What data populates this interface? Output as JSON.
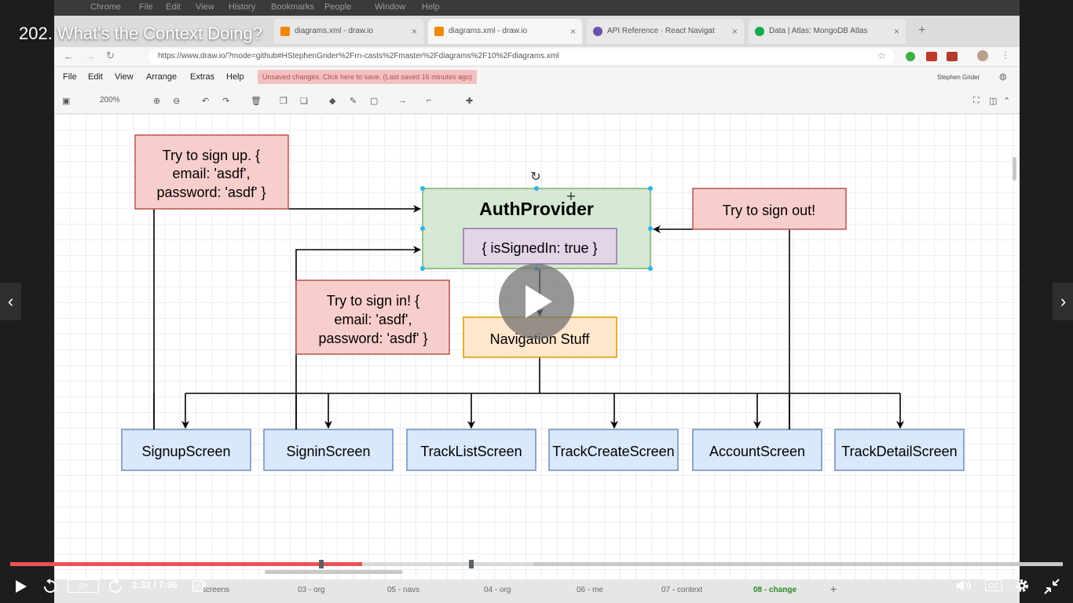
{
  "video_title": "202. What's the Context Doing?",
  "browser": {
    "mac_menu": [
      "Chrome",
      "File",
      "Edit",
      "View",
      "History",
      "Bookmarks",
      "People",
      "Window",
      "Help"
    ],
    "tabs": [
      {
        "label": "diagrams.xml - draw.io",
        "fav_color": "#f08705"
      },
      {
        "label": "diagrams.xml - draw.io",
        "fav_color": "#f08705"
      },
      {
        "label": "API Reference · React Navigat",
        "fav_color": "#6b52ae"
      },
      {
        "label": "Data | Atlas: MongoDB Atlas",
        "fav_color": "#13aa52"
      }
    ],
    "url": "https://www.draw.io/?mode=github#HStephenGrider%2Frn-casts%2Fmaster%2Fdiagrams%2F10%2Fdiagrams.xml"
  },
  "drawio": {
    "menu": [
      "File",
      "Edit",
      "View",
      "Arrange",
      "Extras",
      "Help"
    ],
    "unsaved": "Unsaved changes. Click here to save. (Last saved 16 minutes ago)",
    "user": "Stephen Grider",
    "zoom": "200%",
    "bottom_tabs": [
      "screens",
      "03 - org",
      "05 - navs",
      "04 - org",
      "06 - me",
      "07 - context",
      "08 - change"
    ]
  },
  "diagram": {
    "signup_note": [
      "Try to sign up.  {",
      "email: 'asdf',",
      "password: 'asdf' }"
    ],
    "auth_title": "AuthProvider",
    "auth_state": "{ isSignedIn: true }",
    "signout_note": "Try to sign out!",
    "signin_note": [
      "Try to sign in! {",
      "email: 'asdf',",
      "password: 'asdf' }"
    ],
    "navigation": "Navigation Stuff",
    "screens": [
      "SignupScreen",
      "SigninScreen",
      "TrackListScreen",
      "TrackCreateScreen",
      "AccountScreen",
      "TrackDetailScreen"
    ],
    "colors": {
      "note_fill": "#f8cecc",
      "note_stroke": "#b85450",
      "auth_fill": "#d5e8d4",
      "auth_stroke": "#82b366",
      "state_fill": "#e1d5e7",
      "state_stroke": "#9673a6",
      "nav_fill": "#ffe6cc",
      "nav_stroke": "#d79b00",
      "screen_fill": "#dae8fc",
      "screen_stroke": "#6c8ebf"
    }
  },
  "player": {
    "speed": "2×",
    "time": "2:32 / 7:36",
    "progress": 0.334,
    "buffered": 0.497,
    "cc": "CC",
    "accent": "#ec5252"
  }
}
